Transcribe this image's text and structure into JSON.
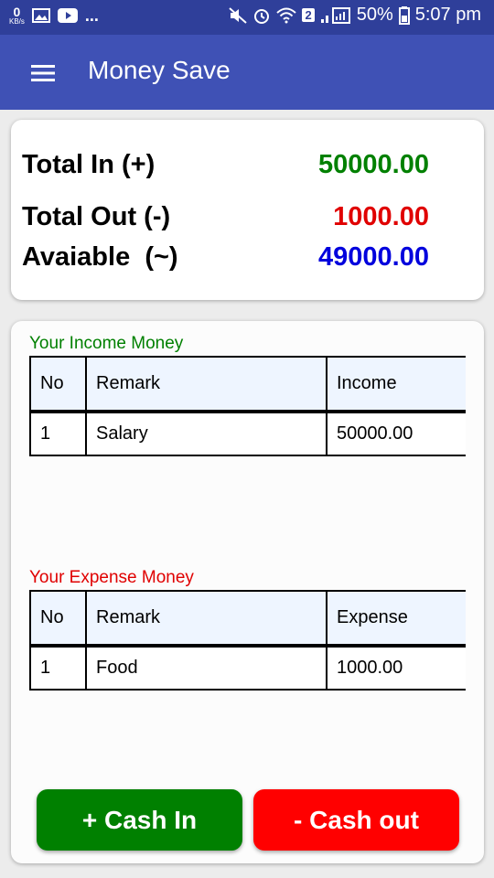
{
  "status_bar": {
    "net_speed_value": "0",
    "net_speed_unit": "KB/s",
    "more": "...",
    "sim_badge": "2",
    "battery": "50%",
    "time": "5:07 pm"
  },
  "app_bar": {
    "title": "Money Save",
    "menu_icon": "hamburger-menu-icon"
  },
  "summary": {
    "total_in_label": "Total In (+)",
    "total_in_value": "50000.00",
    "total_in_color": "#008000",
    "total_out_label": "Total Out (-)",
    "total_out_value": "1000.00",
    "total_out_color": "#e00000",
    "available_label": "Avaiable  (~)",
    "available_value": "49000.00",
    "available_color": "#0000dd"
  },
  "income": {
    "title": "Your Income Money",
    "headers": [
      "No",
      "Remark",
      "Income"
    ],
    "rows": [
      {
        "no": "1",
        "remark": "Salary",
        "amount": "50000.00"
      }
    ]
  },
  "expense": {
    "title": "Your Expense Money",
    "headers": [
      "No",
      "Remark",
      "Expense"
    ],
    "rows": [
      {
        "no": "1",
        "remark": "Food",
        "amount": "1000.00"
      }
    ]
  },
  "buttons": {
    "cash_in": "+ Cash In",
    "cash_out": "- Cash out"
  }
}
